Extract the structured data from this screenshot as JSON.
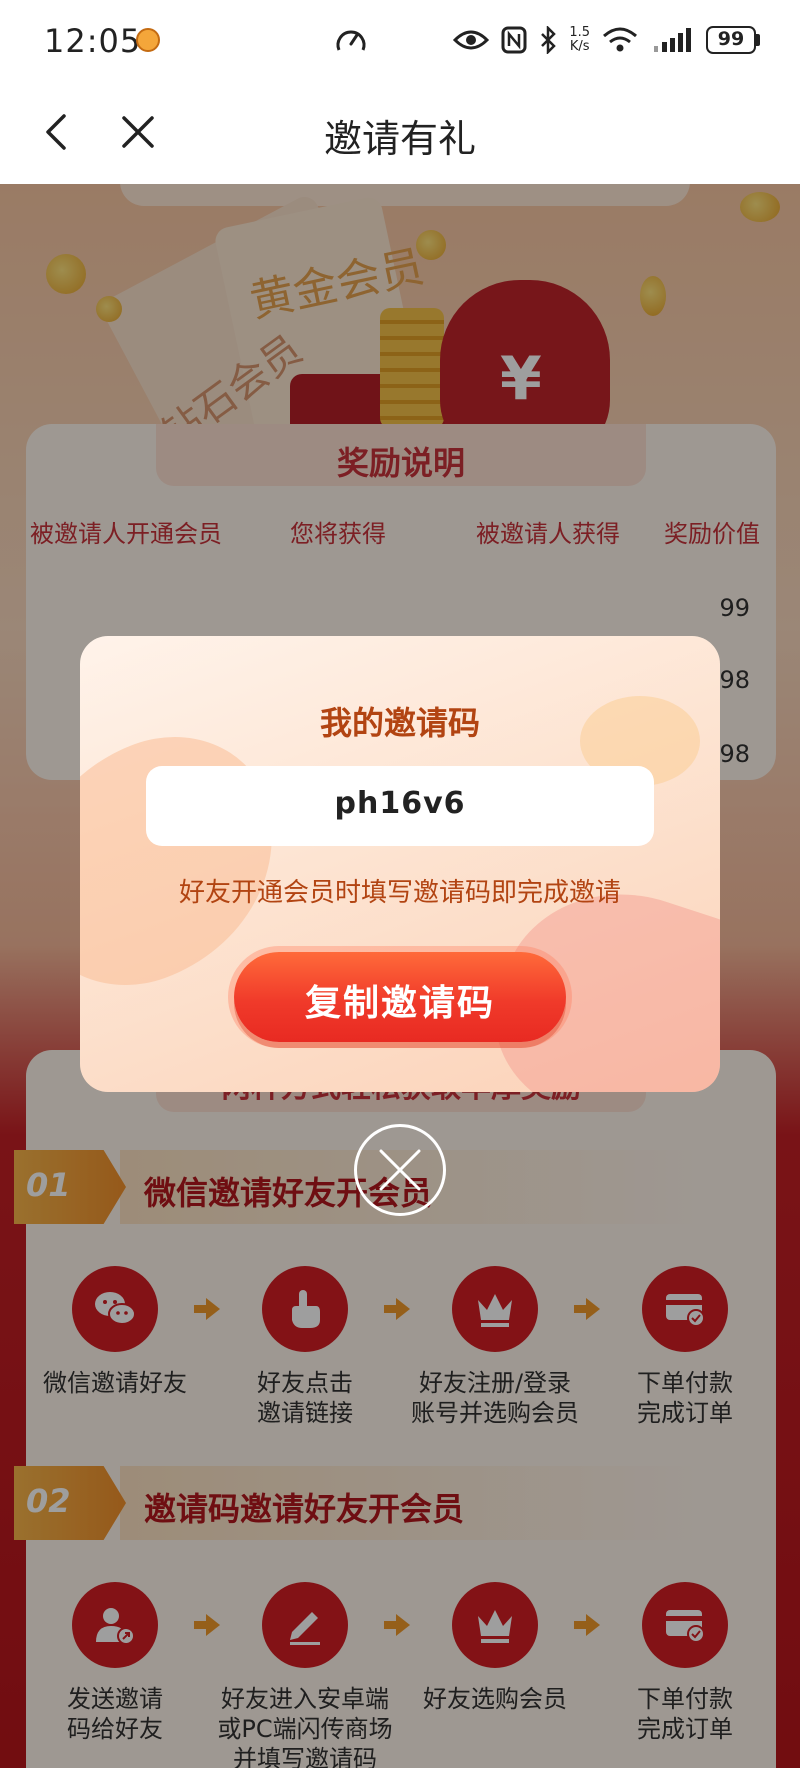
{
  "status_bar": {
    "time": "12:05",
    "net_speed_value": "1.5",
    "net_speed_unit": "K/s",
    "battery": "99"
  },
  "nav": {
    "title": "邀请有礼"
  },
  "hero": {
    "text_gold": "黄金会员",
    "text_diamond": "钻石会员"
  },
  "reward": {
    "title": "奖励说明",
    "headers": [
      "被邀请人开通会员",
      "您将获得",
      "被邀请人获得",
      "奖励价值"
    ],
    "values_visible": [
      "99",
      "98",
      "98"
    ]
  },
  "methods": {
    "title": "两种方式轻松获取丰厚奖励",
    "steps": [
      {
        "num": "01",
        "title": "微信邀请好友开会员",
        "flow": [
          {
            "icon": "wechat-icon",
            "label": "微信邀请好友"
          },
          {
            "icon": "tap-finger-icon",
            "label": "好友点击\n邀请链接"
          },
          {
            "icon": "crown-icon",
            "label": "好友注册/登录\n账号并选购会员"
          },
          {
            "icon": "payment-card-icon",
            "label": "下单付款\n完成订单"
          }
        ]
      },
      {
        "num": "02",
        "title": "邀请码邀请好友开会员",
        "flow": [
          {
            "icon": "user-send-icon",
            "label": "发送邀请\n码给好友"
          },
          {
            "icon": "edit-pen-icon",
            "label": "好友进入安卓端\n或PC端闪传商场\n并填写邀请码"
          },
          {
            "icon": "crown-icon",
            "label": "好友选购会员"
          },
          {
            "icon": "payment-card-icon",
            "label": "下单付款\n完成订单"
          }
        ]
      }
    ]
  },
  "modal": {
    "title": "我的邀请码",
    "code": "ph16v6",
    "hint": "好友开通会员时填写邀请码即完成邀请",
    "copy_button": "复制邀请码"
  },
  "colors": {
    "brand_red": "#d41e24",
    "accent_orange": "#f19a2a",
    "modal_text": "#b24412"
  }
}
